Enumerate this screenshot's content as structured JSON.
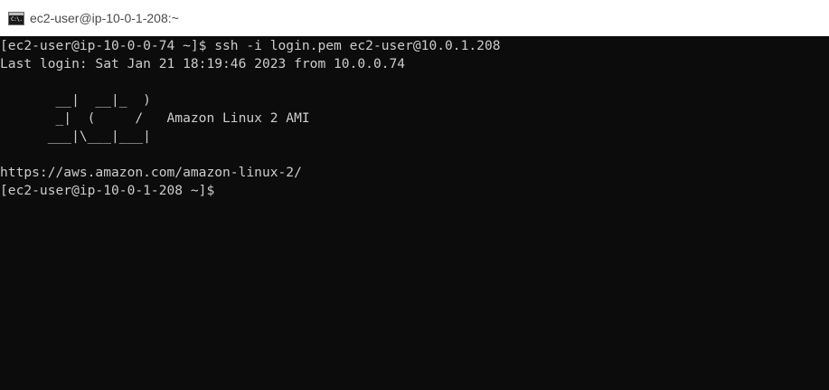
{
  "window": {
    "title": "ec2-user@ip-10-0-1-208:~",
    "icon": "console-app-icon",
    "icon_glyph": "C:\\."
  },
  "terminal": {
    "background": "#0c0c0c",
    "foreground": "#cccccc",
    "lines": [
      "[ec2-user@ip-10-0-0-74 ~]$ ssh -i login.pem ec2-user@10.0.1.208",
      "Last login: Sat Jan 21 18:19:46 2023 from 10.0.0.74",
      "",
      "       __|  __|_  )",
      "       _|  (     /   Amazon Linux 2 AMI",
      "      ___|\\___|___|",
      "",
      "https://aws.amazon.com/amazon-linux-2/",
      "[ec2-user@ip-10-0-1-208 ~]$"
    ]
  }
}
